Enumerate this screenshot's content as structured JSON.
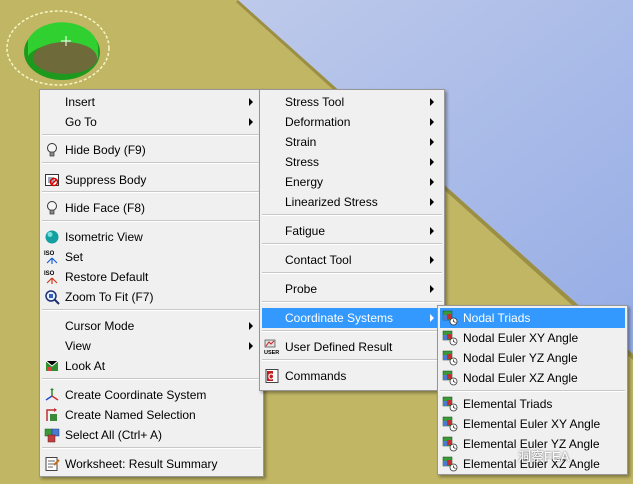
{
  "context_menu": {
    "items": [
      {
        "label": "Insert",
        "submenu": true,
        "icon": ""
      },
      {
        "label": "Go To",
        "submenu": true,
        "icon": ""
      },
      {
        "label": "Hide Body (F9)",
        "submenu": false,
        "icon": "lightbulb-icon"
      },
      {
        "label": "Suppress Body",
        "submenu": false,
        "icon": "suppress-icon"
      },
      {
        "label": "Hide Face (F8)",
        "submenu": false,
        "icon": "lightbulb-icon"
      },
      {
        "label": "Isometric View",
        "submenu": false,
        "icon": "iso-sphere-icon"
      },
      {
        "label": "Set",
        "submenu": false,
        "icon": "iso-set-icon"
      },
      {
        "label": "Restore Default",
        "submenu": false,
        "icon": "iso-restore-icon"
      },
      {
        "label": "Zoom To Fit (F7)",
        "submenu": false,
        "icon": "zoom-fit-icon"
      },
      {
        "label": "Cursor Mode",
        "submenu": true,
        "icon": ""
      },
      {
        "label": "View",
        "submenu": true,
        "icon": ""
      },
      {
        "label": "Look At",
        "submenu": false,
        "icon": "look-at-icon"
      },
      {
        "label": "Create Coordinate System",
        "submenu": false,
        "icon": "coordinate-system-icon"
      },
      {
        "label": "Create Named Selection",
        "submenu": false,
        "icon": "named-selection-icon"
      },
      {
        "label": "Select All (Ctrl+ A)",
        "submenu": false,
        "icon": "select-all-icon"
      },
      {
        "label": "Worksheet: Result Summary",
        "submenu": false,
        "icon": "worksheet-icon"
      }
    ]
  },
  "insert_submenu": {
    "items": [
      {
        "label": "Stress Tool",
        "submenu": true,
        "icon": ""
      },
      {
        "label": "Deformation",
        "submenu": true,
        "icon": ""
      },
      {
        "label": "Strain",
        "submenu": true,
        "icon": ""
      },
      {
        "label": "Stress",
        "submenu": true,
        "icon": ""
      },
      {
        "label": "Energy",
        "submenu": true,
        "icon": ""
      },
      {
        "label": "Linearized Stress",
        "submenu": true,
        "icon": ""
      },
      {
        "label": "Fatigue",
        "submenu": true,
        "icon": ""
      },
      {
        "label": "Contact Tool",
        "submenu": true,
        "icon": ""
      },
      {
        "label": "Probe",
        "submenu": true,
        "icon": ""
      },
      {
        "label": "Coordinate Systems",
        "submenu": true,
        "icon": "",
        "highlighted": true
      },
      {
        "label": "User Defined Result",
        "submenu": false,
        "icon": "user-result-icon"
      },
      {
        "label": "Commands",
        "submenu": false,
        "icon": "commands-icon"
      }
    ]
  },
  "coordinate_submenu": {
    "items": [
      {
        "label": "Nodal Triads",
        "icon": "triad-icon",
        "highlighted": true
      },
      {
        "label": "Nodal Euler XY Angle",
        "icon": "triad-icon"
      },
      {
        "label": "Nodal Euler YZ Angle",
        "icon": "triad-icon"
      },
      {
        "label": "Nodal Euler XZ Angle",
        "icon": "triad-icon"
      },
      {
        "label": "Elemental Triads",
        "icon": "triad-icon"
      },
      {
        "label": "Elemental Euler XY Angle",
        "icon": "triad-icon"
      },
      {
        "label": "Elemental Euler YZ Angle",
        "icon": "triad-icon"
      },
      {
        "label": "Elemental Euler XZ Angle",
        "icon": "triad-icon"
      }
    ]
  },
  "watermark": "洞察FEA",
  "colors": {
    "model_surface": "#c1b664",
    "background_sky": "#a6b8e6",
    "highlight": "#3399ff",
    "selected_face": "#22b422"
  }
}
